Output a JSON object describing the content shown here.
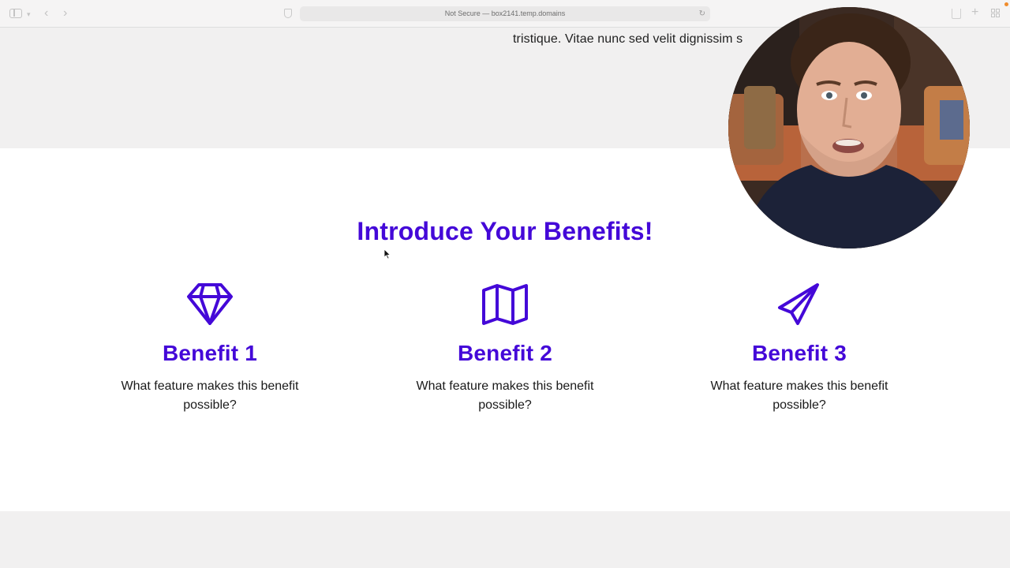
{
  "browser": {
    "address_text": "Not Secure — box2141.temp.domains",
    "icons": [
      "sidebar-icon",
      "chevron-down-icon",
      "back-icon",
      "forward-icon",
      "shield-icon",
      "reload-icon",
      "share-icon",
      "new-tab-icon",
      "tab-overview-icon"
    ],
    "accent_dot_color": "#f08c2c"
  },
  "page": {
    "top_text": "tristique. Vitae nunc sed velit dignissim s",
    "benefits_title": "Introduce Your Benefits!",
    "accent_color": "#4408d8",
    "benefits": [
      {
        "icon": "diamond-icon",
        "title": "Benefit 1",
        "text": "What feature makes this benefit possible?"
      },
      {
        "icon": "map-icon",
        "title": "Benefit 2",
        "text": "What feature makes this benefit possible?"
      },
      {
        "icon": "paper-plane-icon",
        "title": "Benefit 3",
        "text": "What feature makes this benefit possible?"
      }
    ]
  },
  "overlay": {
    "webcam": "presenter-webcam"
  }
}
